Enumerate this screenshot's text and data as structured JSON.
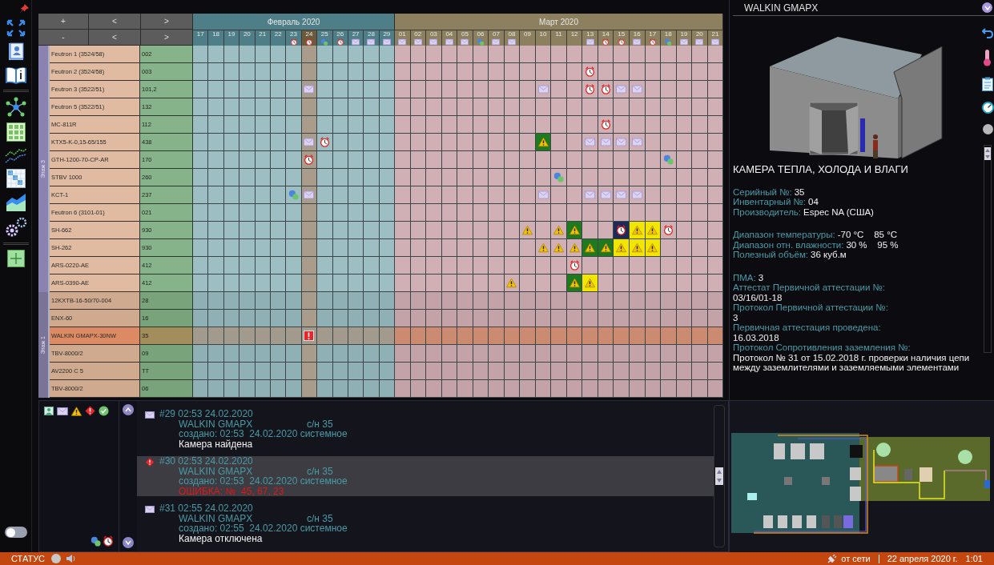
{
  "nav_top": [
    "+",
    "<",
    ">"
  ],
  "nav_bottom": [
    "-",
    "<",
    ">"
  ],
  "months": [
    {
      "title": "Февраль 2020",
      "days": [
        {
          "label": "17",
          "selected": false
        },
        {
          "label": "18",
          "selected": false
        },
        {
          "label": "19",
          "selected": false
        },
        {
          "label": "20",
          "selected": false
        },
        {
          "label": "21",
          "selected": false
        },
        {
          "label": "22",
          "selected": false
        },
        {
          "label": "23",
          "kind": "alarm",
          "selected": false
        },
        {
          "label": "24",
          "kind": "alarm",
          "selected": true
        },
        {
          "label": "25",
          "kind": "chat",
          "selected": false
        },
        {
          "label": "26",
          "kind": "alarm",
          "selected": false
        },
        {
          "label": "27",
          "kind": "mail",
          "selected": false
        },
        {
          "label": "28",
          "kind": "mail",
          "selected": false
        },
        {
          "label": "29",
          "kind": "mail",
          "selected": false
        }
      ]
    },
    {
      "title": "Март 2020",
      "days": [
        {
          "label": "01",
          "kind": "mail",
          "selected": false
        },
        {
          "label": "02",
          "kind": "mail",
          "selected": false
        },
        {
          "label": "03",
          "kind": "mail",
          "selected": false
        },
        {
          "label": "04",
          "kind": "mail",
          "selected": false
        },
        {
          "label": "05",
          "kind": "mail",
          "selected": false
        },
        {
          "label": "06",
          "kind": "chat",
          "selected": false
        },
        {
          "label": "07",
          "kind": "mail",
          "selected": false
        },
        {
          "label": "08",
          "kind": "mail",
          "selected": false
        },
        {
          "label": "09",
          "selected": false
        },
        {
          "label": "10",
          "selected": false
        },
        {
          "label": "11",
          "selected": false
        },
        {
          "label": "12",
          "selected": false
        },
        {
          "label": "13",
          "kind": "mail",
          "selected": false
        },
        {
          "label": "14",
          "kind": "alarm",
          "selected": false
        },
        {
          "label": "15",
          "kind": "alarm",
          "selected": false
        },
        {
          "label": "16",
          "kind": "mail",
          "selected": false
        },
        {
          "label": "17",
          "kind": "alarm",
          "selected": false
        },
        {
          "label": "18",
          "kind": "chat",
          "selected": false
        },
        {
          "label": "19",
          "kind": "mail",
          "selected": false
        },
        {
          "label": "20",
          "kind": "mail",
          "selected": false
        },
        {
          "label": "21",
          "kind": "mail",
          "selected": false
        }
      ]
    }
  ],
  "floors": [
    {
      "label": "Этаж 3",
      "rows": [
        {
          "name": "Feutron 1 (3524/58)",
          "number": "002",
          "selected": false
        },
        {
          "name": "Feutron 2 (3524/58)",
          "number": "003",
          "selected": false,
          "cells": [
            null,
            null,
            null,
            null,
            null,
            null,
            null,
            null,
            null,
            null,
            null,
            null,
            null,
            null,
            null,
            null,
            null,
            null,
            null,
            null,
            null,
            null,
            null,
            null,
            null,
            {
              "kind": "alarm"
            }
          ]
        },
        {
          "name": "Feutron 3 (3522/51)",
          "number": "101,2",
          "selected": false,
          "cells": [
            null,
            null,
            null,
            null,
            null,
            null,
            null,
            {
              "kind": "mail"
            },
            null,
            null,
            null,
            null,
            null,
            null,
            null,
            null,
            null,
            null,
            null,
            null,
            null,
            null,
            {
              "kind": "mail"
            },
            null,
            null,
            {
              "kind": "alarm"
            },
            {
              "kind": "alarm"
            },
            {
              "kind": "mail"
            },
            {
              "kind": "mail"
            }
          ]
        },
        {
          "name": "Feutron 5 (3522/51)",
          "number": "132",
          "selected": false
        },
        {
          "name": "MC-811R",
          "number": "112",
          "selected": false,
          "cells": [
            null,
            null,
            null,
            null,
            null,
            null,
            null,
            null,
            null,
            null,
            null,
            null,
            null,
            null,
            null,
            null,
            null,
            null,
            null,
            null,
            null,
            null,
            null,
            null,
            null,
            null,
            {
              "kind": "alarm"
            }
          ]
        },
        {
          "name": "KTX5-K-0,15-65/155",
          "number": "438",
          "selected": false,
          "cells": [
            null,
            null,
            null,
            null,
            null,
            null,
            null,
            {
              "kind": "mail"
            },
            {
              "kind": "alarm"
            },
            null,
            null,
            null,
            null,
            null,
            null,
            null,
            null,
            null,
            null,
            null,
            null,
            null,
            {
              "kind": "warning",
              "color": "#1f7a1f"
            },
            null,
            null,
            {
              "kind": "mail"
            },
            {
              "kind": "mail"
            },
            {
              "kind": "mail"
            },
            {
              "kind": "mail"
            }
          ]
        },
        {
          "name": "GTH-1200-70-CP-AR",
          "number": "170",
          "selected": false,
          "cells": [
            null,
            null,
            null,
            null,
            null,
            null,
            null,
            {
              "kind": "alarm"
            },
            null,
            null,
            null,
            null,
            null,
            null,
            null,
            null,
            null,
            null,
            null,
            null,
            null,
            null,
            null,
            null,
            null,
            null,
            null,
            null,
            null,
            null,
            {
              "kind": "chat"
            }
          ]
        },
        {
          "name": "STBV 1000",
          "number": "260",
          "selected": false,
          "cells": [
            null,
            null,
            null,
            null,
            null,
            null,
            null,
            null,
            null,
            null,
            null,
            null,
            null,
            null,
            null,
            null,
            null,
            null,
            null,
            null,
            null,
            null,
            null,
            {
              "kind": "chat"
            }
          ]
        },
        {
          "name": "KCT-1",
          "number": "237",
          "selected": false,
          "cells": [
            null,
            null,
            null,
            null,
            null,
            null,
            {
              "kind": "chat"
            },
            {
              "kind": "mail"
            },
            null,
            null,
            null,
            null,
            null,
            null,
            null,
            null,
            null,
            null,
            null,
            null,
            null,
            null,
            {
              "kind": "mail"
            },
            null,
            null,
            {
              "kind": "mail"
            },
            {
              "kind": "mail"
            },
            {
              "kind": "mail"
            },
            {
              "kind": "mail"
            }
          ]
        },
        {
          "name": "Feutron 6 (3101-01)",
          "number": "021",
          "selected": false
        },
        {
          "name": "SH-662",
          "number": "930",
          "selected": false,
          "cells": [
            null,
            null,
            null,
            null,
            null,
            null,
            null,
            null,
            null,
            null,
            null,
            null,
            null,
            null,
            null,
            null,
            null,
            null,
            null,
            null,
            null,
            {
              "kind": "warning"
            },
            null,
            {
              "kind": "warning"
            },
            {
              "kind": "warning",
              "color": "#1f7a1f"
            },
            null,
            null,
            {
              "kind": "alarm",
              "color": "#1c2a5a"
            },
            {
              "kind": "warning",
              "color": "#f2e600"
            },
            {
              "kind": "warning",
              "color": "#f2e600"
            },
            {
              "kind": "alarm"
            }
          ]
        },
        {
          "name": "SH-262",
          "number": "930",
          "selected": false,
          "cells": [
            null,
            null,
            null,
            null,
            null,
            null,
            null,
            null,
            null,
            null,
            null,
            null,
            null,
            null,
            null,
            null,
            null,
            null,
            null,
            null,
            null,
            null,
            {
              "kind": "warning"
            },
            {
              "kind": "warning"
            },
            {
              "kind": "warning"
            },
            {
              "kind": "warning",
              "color": "#1f7a1f"
            },
            {
              "kind": "warning",
              "color": "#1f7a1f"
            },
            {
              "kind": "warning",
              "color": "#f2e600"
            },
            {
              "kind": "warning",
              "color": "#f2e600"
            },
            {
              "kind": "warning",
              "color": "#f2e600"
            }
          ]
        },
        {
          "name": "ARS-0220-AE",
          "number": "412",
          "selected": false,
          "cells": [
            null,
            null,
            null,
            null,
            null,
            null,
            null,
            null,
            null,
            null,
            null,
            null,
            null,
            null,
            null,
            null,
            null,
            null,
            null,
            null,
            null,
            null,
            null,
            null,
            {
              "kind": "alarm"
            }
          ]
        },
        {
          "name": "ARS-0390-AE",
          "number": "412",
          "selected": false,
          "cells": [
            null,
            null,
            null,
            null,
            null,
            null,
            null,
            null,
            null,
            null,
            null,
            null,
            null,
            null,
            null,
            null,
            null,
            null,
            null,
            null,
            {
              "kind": "warning"
            },
            null,
            null,
            null,
            {
              "kind": "warning",
              "color": "#1f7a1f"
            },
            {
              "kind": "warning",
              "color": "#f2e600"
            }
          ]
        }
      ]
    },
    {
      "label": "Этаж 1",
      "rows": [
        {
          "name": "12KXTB-16-50/70-004",
          "number": "28",
          "selected": false
        },
        {
          "name": "ENX-60",
          "number": "16",
          "selected": false
        },
        {
          "name": "WALKIN GMAPX-30NW",
          "number": "35",
          "selected": true,
          "cells": [
            null,
            null,
            null,
            null,
            null,
            null,
            null,
            {
              "kind": "error"
            }
          ]
        },
        {
          "name": "TBV-8000/2",
          "number": "09",
          "selected": false
        },
        {
          "name": "AV2200 C 5",
          "number": "TT",
          "selected": false
        },
        {
          "name": "TBV-8000/2",
          "number": "06",
          "selected": false
        }
      ]
    }
  ],
  "log": {
    "entries": [
      {
        "kind": "mail",
        "header": "#29 02:53 24.02.2020",
        "device": "WALKIN GMAPX",
        "serial": "с/н 35",
        "created": "создано: 02:53  24.02.2020 системное",
        "message": "Камера найдена",
        "error": false,
        "selected": false
      },
      {
        "kind": "error",
        "header": "#30 02:53 24.02.2020",
        "device": "WALKIN GMAPX",
        "serial": "с/н 35",
        "created": "создано: 02:53  24.02.2020 системное",
        "message": "ОШИБКА: №  45, 67, 23",
        "error": true,
        "selected": true
      },
      {
        "kind": "mail",
        "header": "#31 02:55 24.02.2020",
        "device": "WALKIN GMAPX",
        "serial": "с/н 35",
        "created": "создано: 02:55  24.02.2020 системное",
        "message": "Камера отключена",
        "error": false,
        "selected": false
      }
    ]
  },
  "toggle": {
    "on": false
  },
  "details": {
    "title": "WALKIN GMAPX",
    "heading": "КАМЕРА ТЕПЛА, ХОЛОДА И ВЛАГИ",
    "groups": [
      [
        {
          "label": "Серийный №:",
          "value": "35",
          "kind": "inline"
        },
        {
          "label": "Инвентарный №:",
          "value": "04",
          "kind": "inline"
        },
        {
          "label": "Производитель:",
          "value": "Espec NA (США)",
          "kind": "inline"
        }
      ],
      [
        {
          "label": "Диапазон температуры:",
          "value": "-70 °C    85 °C",
          "kind": "inline"
        },
        {
          "label": "Диапазон отн. влажности:",
          "value": "30 %    95 %",
          "kind": "inline"
        },
        {
          "label": "Полезный объём:",
          "value": "36 куб.м",
          "kind": "inline"
        }
      ],
      [
        {
          "label": "ПМА:",
          "value": "3",
          "kind": "inline"
        },
        {
          "label": "Аттестат Первичной аттестации №:",
          "value": "03/16/01-18",
          "kind": "block"
        },
        {
          "label": "Протокол Первичной аттестации №:",
          "value": "3",
          "kind": "block"
        },
        {
          "label": "Первичная аттестация проведена:",
          "value": "16.03.2018",
          "kind": "block"
        },
        {
          "label": "Протокол Сопротивления заземления №:",
          "value": "Протокол № 31 от 15.02.2018 г. проверки наличия цепи между заземлителями и заземляемыми элементами",
          "kind": "block"
        }
      ]
    ]
  },
  "status_bar": {
    "label": "СТАТУС",
    "power": "от сети",
    "date": "22 апреля 2020 г.",
    "time": "1:01"
  }
}
